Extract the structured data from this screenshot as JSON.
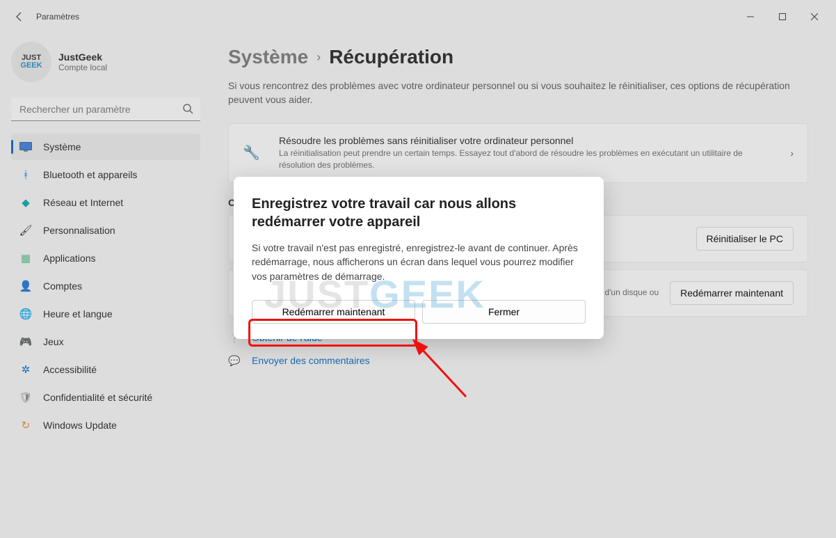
{
  "app": {
    "title": "Paramètres"
  },
  "account": {
    "name": "JustGeek",
    "type": "Compte local",
    "logo_top": "JUST",
    "logo_bottom": "GEEK"
  },
  "search": {
    "placeholder": "Rechercher un paramètre"
  },
  "nav": [
    {
      "label": "Système",
      "icon": "🖥️",
      "active": true
    },
    {
      "label": "Bluetooth et appareils",
      "icon": "bt"
    },
    {
      "label": "Réseau et Internet",
      "icon": "📶"
    },
    {
      "label": "Personnalisation",
      "icon": "🖌️"
    },
    {
      "label": "Applications",
      "icon": "▦"
    },
    {
      "label": "Comptes",
      "icon": "👤"
    },
    {
      "label": "Heure et langue",
      "icon": "🌐"
    },
    {
      "label": "Jeux",
      "icon": "🎮"
    },
    {
      "label": "Accessibilité",
      "icon": "♿"
    },
    {
      "label": "Confidentialité et sécurité",
      "icon": "🛡️"
    },
    {
      "label": "Windows Update",
      "icon": "↻"
    }
  ],
  "breadcrumb": {
    "parent": "Système",
    "current": "Récupération"
  },
  "intro": "Si vous rencontrez des problèmes avec votre ordinateur personnel ou si vous souhaitez le réinitialiser, ces options de récupération peuvent vous aider.",
  "troubleshoot": {
    "title": "Résoudre les problèmes sans réinitialiser votre ordinateur personnel",
    "desc": "La réinitialisation peut prendre un certain temps. Essayez tout d'abord de résoudre les problèmes en exécutant un utilitaire de résolution des problèmes."
  },
  "recovery_section_label": "O",
  "reset": {
    "button": "Réinitialiser le PC"
  },
  "advanced": {
    "desc_fragment": "d'un disque ou",
    "button": "Redémarrer maintenant"
  },
  "links": {
    "help": "Obtenir de l'aide",
    "feedback": "Envoyer des commentaires"
  },
  "dialog": {
    "title": "Enregistrez votre travail car nous allons redémarrer votre appareil",
    "body": "Si votre travail n'est pas enregistré, enregistrez-le avant de continuer. Après redémarrage, nous afficherons un écran dans lequel vous pourrez modifier vos paramètres de démarrage.",
    "restart": "Redémarrer maintenant",
    "close": "Fermer"
  },
  "watermark": {
    "j": "JUST",
    "g": "GEEK"
  },
  "colors": {
    "accent": "#0067c0",
    "highlight": "#e11"
  }
}
